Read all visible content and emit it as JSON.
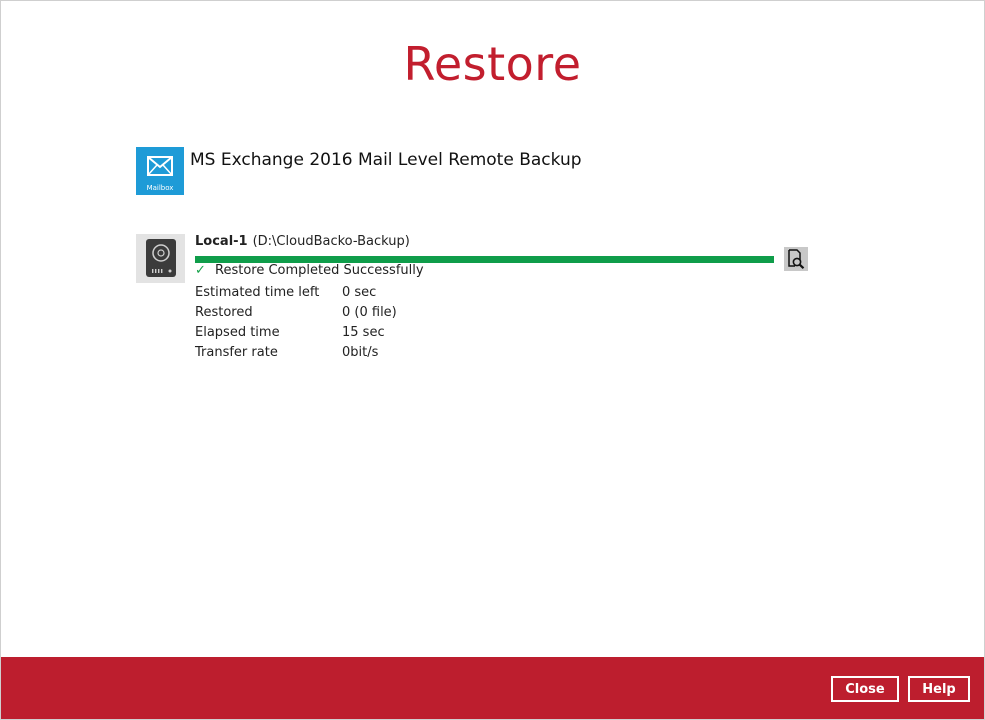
{
  "page": {
    "title": "Restore"
  },
  "backup_set": {
    "icon": "mailbox-icon",
    "icon_caption": "Mailbox",
    "name": "MS Exchange 2016 Mail Level Remote Backup"
  },
  "destination": {
    "icon": "hard-drive-icon",
    "name": "Local-1",
    "path": "(D:\\CloudBacko-Backup)",
    "progress": 1.0,
    "progress_color": "#0f9d4a",
    "status": "Restore Completed Successfully",
    "stats": [
      {
        "label": "Estimated time left",
        "value": "0 sec"
      },
      {
        "label": "Restored",
        "value": "0 (0 file)"
      },
      {
        "label": "Elapsed time",
        "value": "15 sec"
      },
      {
        "label": "Transfer rate",
        "value": "0bit/s"
      }
    ]
  },
  "footer": {
    "close_label": "Close",
    "help_label": "Help",
    "background": "#bd1e2e"
  },
  "colors": {
    "accent": "#c21e2e",
    "mailbox": "#1e9bd7"
  }
}
